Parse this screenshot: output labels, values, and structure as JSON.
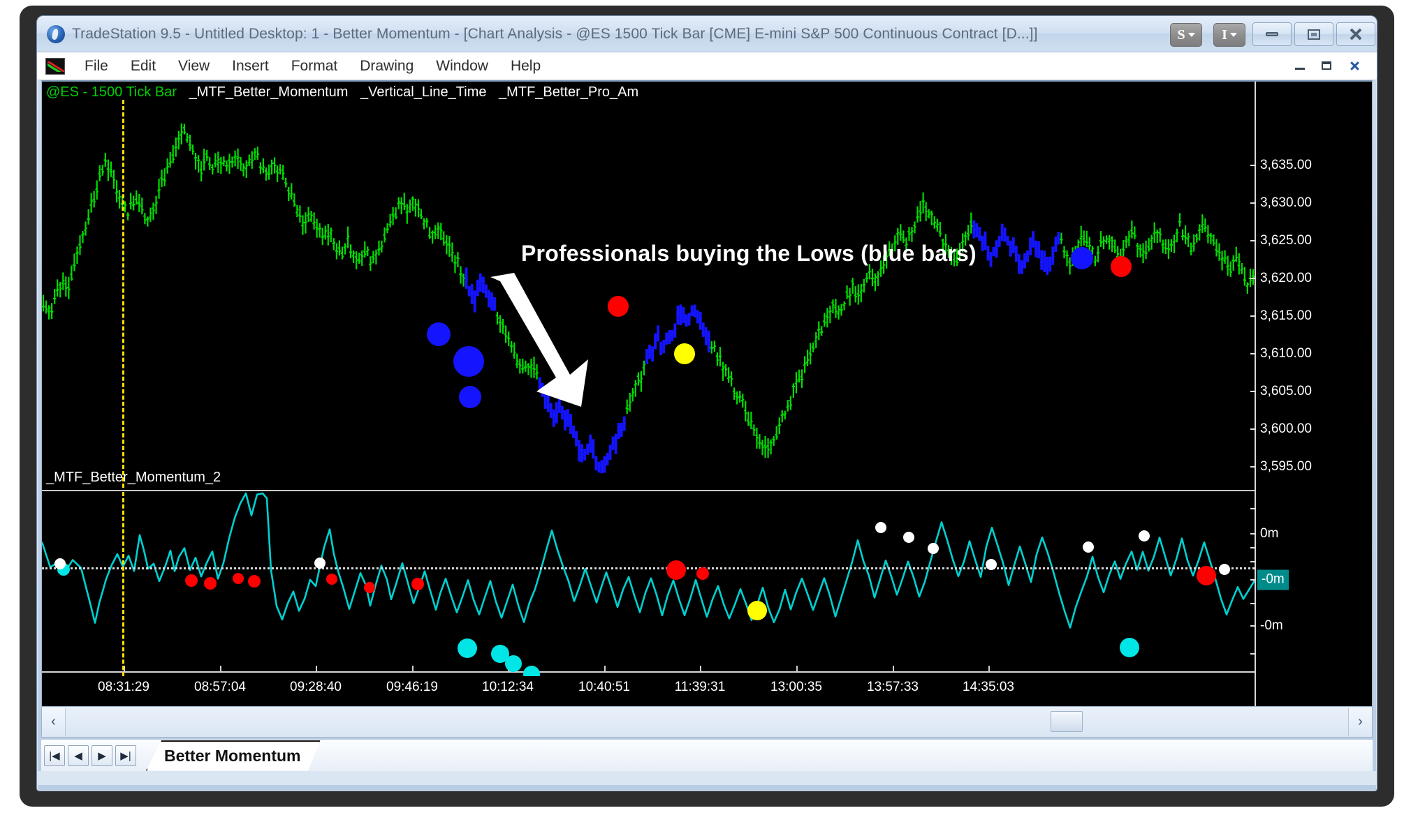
{
  "window": {
    "title": "TradeStation 9.5 - Untitled Desktop: 1 - Better Momentum - [Chart Analysis - @ES 1500 Tick Bar [CME] E-mini S&P 500 Continuous Contract [D...]]",
    "tool_buttons": [
      {
        "label": "S",
        "name": "symbol-dropdown"
      },
      {
        "label": "I",
        "name": "interval-dropdown"
      }
    ],
    "controls": {
      "minimize": "minimize",
      "maximize": "maximize",
      "close": "close"
    },
    "mdi_controls": {
      "minimize": "restore-down-minimize",
      "restore": "restore",
      "close": "close-document"
    }
  },
  "menu": {
    "items": [
      "File",
      "Edit",
      "View",
      "Insert",
      "Format",
      "Drawing",
      "Window",
      "Help"
    ]
  },
  "chart": {
    "legend": {
      "symbol": "@ES - 1500 Tick Bar",
      "indicators": [
        "_MTF_Better_Momentum",
        "_Vertical_Line_Time",
        "_MTF_Better_Pro_Am"
      ]
    },
    "annotation": "Professionals buying the Lows (blue bars)",
    "subpane_label": "_MTF_Better_Momentum_2",
    "colors": {
      "background": "#000000",
      "up_bar": "#00dd00",
      "pro_bar": "#1414ff",
      "momentum_line": "#00d0d0",
      "sell_dot": "#ff0000",
      "buy_dot": "#1414ff",
      "neutral_dot": "#ffff00",
      "cyan_dot": "#00e5e5",
      "white_dot": "#ffffff",
      "vertical_line": "#ffe000",
      "axis_text": "#ffffff",
      "highlight_band": "#008b8b"
    }
  },
  "tabs": {
    "nav": [
      "|◀",
      "◀",
      "▶",
      "▶|"
    ],
    "active": "Better Momentum"
  },
  "scrollbar": {
    "left_arrow": "‹",
    "right_arrow": "›"
  },
  "chart_data": {
    "type": "line",
    "title": "@ES 1500 Tick Bar [CME] E-mini S&P 500 Continuous Contract",
    "xlabel": "",
    "ylabel": "",
    "grid": false,
    "legend_position": "top-left",
    "price_axis": {
      "ticks": [
        "3,635.00",
        "3,630.00",
        "3,625.00",
        "3,620.00",
        "3,615.00",
        "3,610.00",
        "3,605.00",
        "3,600.00",
        "3,595.00"
      ],
      "values": [
        3635,
        3630,
        3625,
        3620,
        3615,
        3610,
        3605,
        3600,
        3595
      ],
      "ylim": [
        3592,
        3637
      ]
    },
    "momentum_axis": {
      "ticks": [
        "0m",
        "-0m",
        "-0m"
      ],
      "highlighted_tick": "-0m"
    },
    "time_axis": {
      "ticks": [
        "08:31:29",
        "08:57:04",
        "09:28:40",
        "09:46:19",
        "10:12:34",
        "10:40:51",
        "11:39:31",
        "13:00:35",
        "13:57:33",
        "14:35:03"
      ]
    },
    "series": [
      {
        "name": "Price bars (@ES 1500 Tick)",
        "color_up": "#00dd00",
        "color_professional": "#1414ff",
        "values": [
          3613.2,
          3612.1,
          3614.0,
          3616.3,
          3615.1,
          3617.6,
          3620.4,
          3622.6,
          3624.8,
          3627.1,
          3629.8,
          3628.4,
          3626.9,
          3625.2,
          3623.7,
          3625.6,
          3624.2,
          3622.8,
          3624.4,
          3626.2,
          3628.1,
          3630.2,
          3631.8,
          3633.6,
          3632.2,
          3630.6,
          3629.1,
          3630.4,
          3629.3,
          3630.1,
          3629.4,
          3630.2,
          3629.6,
          3628.9,
          3629.8,
          3630.4,
          3629.1,
          3628.2,
          3629.6,
          3628.4,
          3627.0,
          3625.6,
          3624.1,
          3622.6,
          3623.8,
          3622.2,
          3620.9,
          3621.8,
          3620.4,
          3619.2,
          3620.6,
          3619.4,
          3618.3,
          3619.6,
          3618.2,
          3619.1,
          3620.6,
          3622.2,
          3623.9,
          3625.2,
          3624.1,
          3625.4,
          3624.0,
          3622.6,
          3621.2,
          3622.4,
          3621.0,
          3619.6,
          3618.2,
          3616.8,
          3615.4,
          3614.0,
          3616.1,
          3614.6,
          3613.2,
          3611.6,
          3610.1,
          3608.6,
          3607.0,
          3605.4,
          3606.8,
          3605.2,
          3603.6,
          3602.0,
          3600.4,
          3601.8,
          3600.2,
          3598.6,
          3597.0,
          3595.4,
          3596.8,
          3595.2,
          3594.0,
          3595.6,
          3597.2,
          3599.0,
          3600.8,
          3602.6,
          3604.4,
          3606.2,
          3607.8,
          3609.4,
          3608.0,
          3609.6,
          3611.2,
          3612.8,
          3611.4,
          3612.9,
          3611.5,
          3610.1,
          3608.7,
          3607.3,
          3605.9,
          3604.5,
          3603.1,
          3601.7,
          3600.3,
          3598.9,
          3597.5,
          3596.1,
          3597.6,
          3599.2,
          3600.8,
          3602.4,
          3604.0,
          3605.6,
          3607.2,
          3608.8,
          3610.4,
          3612.0,
          3613.6,
          3612.2,
          3613.8,
          3615.4,
          3614.0,
          3615.6,
          3617.2,
          3616.0,
          3617.4,
          3618.8,
          3620.2,
          3621.6,
          3620.2,
          3621.8,
          3623.4,
          3625.0,
          3623.6,
          3622.2,
          3620.8,
          3619.4,
          3618.0,
          3619.6,
          3621.2,
          3622.8,
          3621.4,
          3620.0,
          3618.6,
          3620.1,
          3621.7,
          3620.3,
          3618.9,
          3617.5,
          3619.0,
          3620.6,
          3619.2,
          3617.8,
          3619.4,
          3620.9,
          3619.5,
          3618.1,
          3619.7,
          3621.2,
          3619.8,
          3618.4,
          3620.0,
          3621.5,
          3620.1,
          3618.7,
          3620.2,
          3621.8,
          3620.4,
          3619.0,
          3620.5,
          3622.1,
          3620.7,
          3619.3,
          3620.8,
          3622.4,
          3621.0,
          3619.6,
          3621.1,
          3622.7,
          3621.3,
          3619.9,
          3618.5,
          3617.1,
          3618.6,
          3617.2,
          3615.8,
          3617.3
        ]
      },
      {
        "name": "_MTF_Better_Momentum_2",
        "color": "#00d0d0",
        "zero_line": 0
      }
    ],
    "markers": {
      "price_pane": [
        {
          "kind": "buy",
          "color": "#1414ff",
          "x_pct": 32.7,
          "y_pct": 60.5,
          "r": 17
        },
        {
          "kind": "buy",
          "color": "#1414ff",
          "x_pct": 35.2,
          "y_pct": 67.5,
          "r": 22
        },
        {
          "kind": "buy",
          "color": "#1414ff",
          "x_pct": 35.3,
          "y_pct": 76.6,
          "r": 16
        },
        {
          "kind": "sell",
          "color": "#ff0000",
          "x_pct": 47.5,
          "y_pct": 53.2,
          "r": 15
        },
        {
          "kind": "neutral",
          "color": "#ffff00",
          "x_pct": 53.0,
          "y_pct": 65.5,
          "r": 15
        },
        {
          "kind": "buy",
          "color": "#1414ff",
          "x_pct": 85.8,
          "y_pct": 40.9,
          "r": 16
        },
        {
          "kind": "sell",
          "color": "#ff0000",
          "x_pct": 89.0,
          "y_pct": 43.0,
          "r": 15
        }
      ],
      "momentum_pane": [
        {
          "kind": "cyan",
          "color": "#00e5e5",
          "x_pct": 1.8,
          "y_pct": 42.0,
          "r": 9
        },
        {
          "kind": "white",
          "color": "#ffffff",
          "x_pct": 1.5,
          "y_pct": 39.0,
          "r": 8
        },
        {
          "kind": "sell",
          "color": "#ff0000",
          "x_pct": 12.3,
          "y_pct": 48.0,
          "r": 9
        },
        {
          "kind": "sell",
          "color": "#ff0000",
          "x_pct": 13.9,
          "y_pct": 49.5,
          "r": 9
        },
        {
          "kind": "sell",
          "color": "#ff0000",
          "x_pct": 16.2,
          "y_pct": 47.0,
          "r": 8
        },
        {
          "kind": "sell",
          "color": "#ff0000",
          "x_pct": 17.5,
          "y_pct": 48.5,
          "r": 9
        },
        {
          "kind": "white",
          "color": "#ffffff",
          "x_pct": 22.9,
          "y_pct": 38.5,
          "r": 8
        },
        {
          "kind": "sell",
          "color": "#ff0000",
          "x_pct": 23.9,
          "y_pct": 47.5,
          "r": 8
        },
        {
          "kind": "sell",
          "color": "#ff0000",
          "x_pct": 27.0,
          "y_pct": 52.0,
          "r": 8
        },
        {
          "kind": "sell",
          "color": "#ff0000",
          "x_pct": 31.0,
          "y_pct": 50.0,
          "r": 9
        },
        {
          "kind": "cyan",
          "color": "#00e5e5",
          "x_pct": 35.1,
          "y_pct": 85.0,
          "r": 14
        },
        {
          "kind": "cyan",
          "color": "#00e5e5",
          "x_pct": 37.8,
          "y_pct": 88.0,
          "r": 13
        },
        {
          "kind": "cyan",
          "color": "#00e5e5",
          "x_pct": 38.9,
          "y_pct": 93.0,
          "r": 12
        },
        {
          "kind": "cyan",
          "color": "#00e5e5",
          "x_pct": 40.4,
          "y_pct": 99.0,
          "r": 12
        },
        {
          "kind": "sell",
          "color": "#ff0000",
          "x_pct": 52.3,
          "y_pct": 42.5,
          "r": 14
        },
        {
          "kind": "sell",
          "color": "#ff0000",
          "x_pct": 54.5,
          "y_pct": 44.5,
          "r": 9
        },
        {
          "kind": "neutral",
          "color": "#ffff00",
          "x_pct": 59.0,
          "y_pct": 64.5,
          "r": 14
        },
        {
          "kind": "white",
          "color": "#ffffff",
          "x_pct": 69.2,
          "y_pct": 19.5,
          "r": 8
        },
        {
          "kind": "white",
          "color": "#ffffff",
          "x_pct": 71.5,
          "y_pct": 24.5,
          "r": 8
        },
        {
          "kind": "white",
          "color": "#ffffff",
          "x_pct": 73.5,
          "y_pct": 30.5,
          "r": 8
        },
        {
          "kind": "white",
          "color": "#ffffff",
          "x_pct": 78.3,
          "y_pct": 39.5,
          "r": 8
        },
        {
          "kind": "white",
          "color": "#ffffff",
          "x_pct": 86.3,
          "y_pct": 30.0,
          "r": 8
        },
        {
          "kind": "white",
          "color": "#ffffff",
          "x_pct": 90.9,
          "y_pct": 24.0,
          "r": 8
        },
        {
          "kind": "sell",
          "color": "#ff0000",
          "x_pct": 96.0,
          "y_pct": 45.5,
          "r": 14
        },
        {
          "kind": "cyan",
          "color": "#00e5e5",
          "x_pct": 89.7,
          "y_pct": 84.5,
          "r": 14
        },
        {
          "kind": "white",
          "color": "#ffffff",
          "x_pct": 97.5,
          "y_pct": 42.0,
          "r": 8
        }
      ]
    }
  }
}
